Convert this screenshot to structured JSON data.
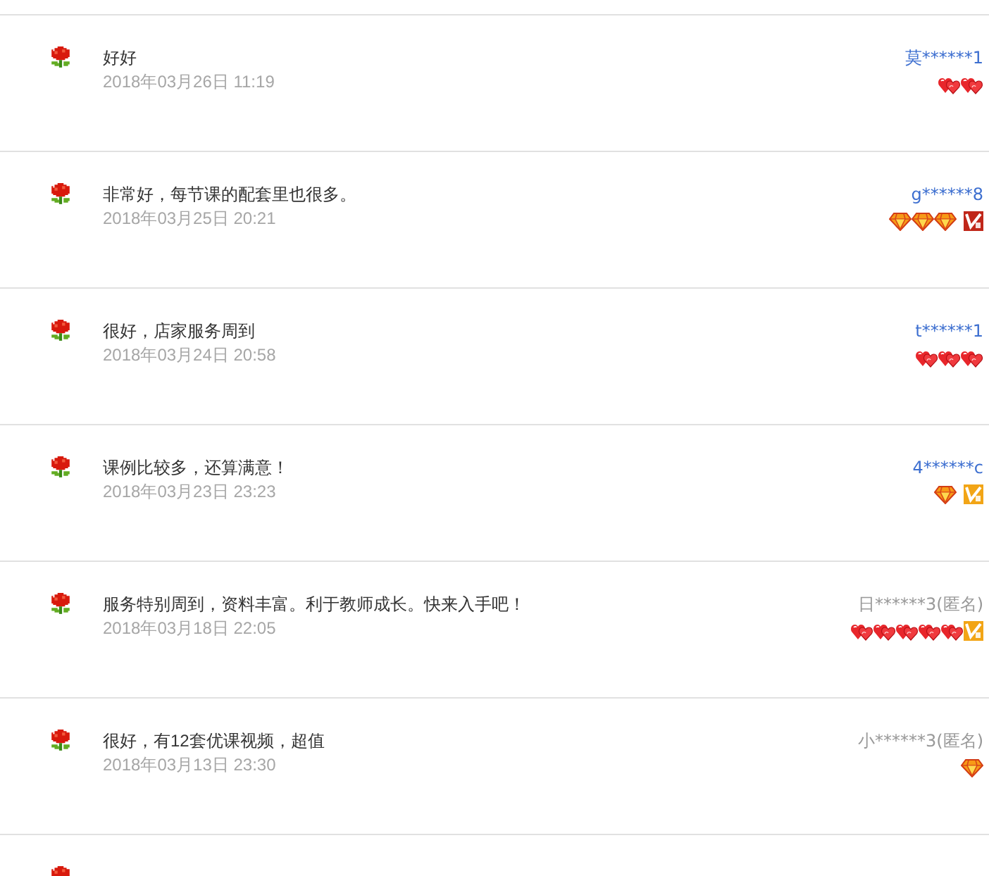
{
  "reviews": [
    {
      "comment": "好好",
      "date": "2018年03月26日 11:19",
      "user": "莫******1",
      "anonymous": false,
      "rank_icons": [
        {
          "kind": "heart"
        },
        {
          "kind": "heart"
        }
      ]
    },
    {
      "comment": "非常好，每节课的配套里也很多。",
      "date": "2018年03月25日 20:21",
      "user": "g******8",
      "anonymous": false,
      "rank_icons": [
        {
          "kind": "diamond"
        },
        {
          "kind": "diamond"
        },
        {
          "kind": "diamond"
        }
      ],
      "badge": {
        "color": "#c0271a"
      }
    },
    {
      "comment": "很好，店家服务周到",
      "date": "2018年03月24日 20:58",
      "user": "t******1",
      "anonymous": false,
      "rank_icons": [
        {
          "kind": "heart"
        },
        {
          "kind": "heart"
        },
        {
          "kind": "heart"
        }
      ]
    },
    {
      "comment": "课例比较多，还算满意！",
      "date": "2018年03月23日 23:23",
      "user": "4******c",
      "anonymous": false,
      "rank_icons": [
        {
          "kind": "diamond"
        }
      ],
      "badge": {
        "color": "#f2a516"
      }
    },
    {
      "comment": "服务特别周到，资料丰富。利于教师成长。快来入手吧！",
      "date": "2018年03月18日 22:05",
      "user": "日******3(匿名)",
      "anonymous": true,
      "rank_icons": [
        {
          "kind": "heart"
        },
        {
          "kind": "heart"
        },
        {
          "kind": "heart"
        },
        {
          "kind": "heart"
        },
        {
          "kind": "heart"
        }
      ],
      "badge": {
        "color": "#f2a516"
      }
    },
    {
      "comment": "很好，有12套优课视频，超值",
      "date": "2018年03月13日 23:30",
      "user": "小******3(匿名)",
      "anonymous": true,
      "rank_icons": [
        {
          "kind": "diamond"
        }
      ]
    }
  ]
}
